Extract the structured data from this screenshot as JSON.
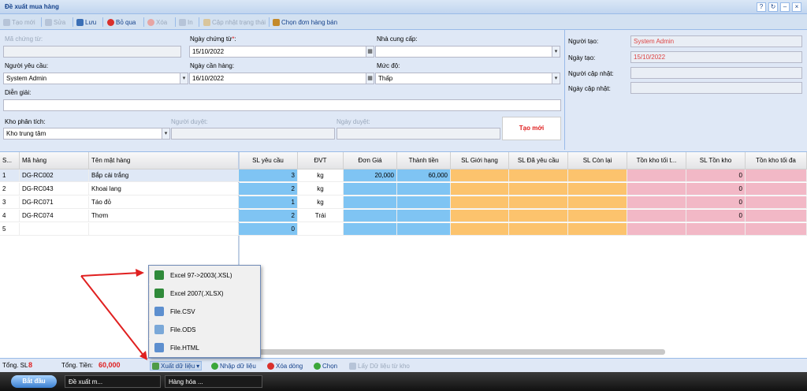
{
  "window": {
    "title": "Đề xuất mua hàng"
  },
  "toolbar": {
    "new": "Tạo mới",
    "edit": "Sửa",
    "save": "Lưu",
    "skip": "Bỏ qua",
    "delete": "Xóa",
    "print": "In",
    "update_status": "Cập nhật trạng thái",
    "choose_order": "Chọn đơn hàng bán"
  },
  "form": {
    "doc_code_label": "Mã chứng từ:",
    "doc_code_value": "",
    "doc_date_label": "Ngày chứng từ",
    "required_mark": "*",
    "doc_date_value": "15/10/2022",
    "supplier_label": "Nhà cung cấp:",
    "supplier_value": "",
    "requester_label": "Người yêu cầu:",
    "requester_value": "System Admin",
    "need_date_label": "Ngày cần hàng:",
    "need_date_value": "16/10/2022",
    "level_label": "Mức độ:",
    "level_value": "Thấp",
    "desc_label": "Diễn giải:",
    "desc_value": "",
    "warehouse_label": "Kho phân tích:",
    "warehouse_value": "Kho trung tâm",
    "approver_label": "Người duyệt:",
    "approver_value": "",
    "approve_date_label": "Ngày duyệt:",
    "approve_date_value": "",
    "status_badge": "Tạo mới"
  },
  "meta": {
    "creator_label": "Người tạo:",
    "creator_value": "System Admin",
    "created_label": "Ngày tạo:",
    "created_value": "15/10/2022",
    "updater_label": "Người cập nhật:",
    "updater_value": "",
    "updated_label": "Ngày cập nhật:",
    "updated_value": ""
  },
  "grid": {
    "headers": [
      "S...",
      "Mã hàng",
      "Tên mặt hàng",
      "SL yêu cầu",
      "ĐVT",
      "Đơn Giá",
      "Thành tiền",
      "SL Giới hạng",
      "SL Đã yêu cầu",
      "SL Còn lại",
      "Tồn kho tối t...",
      "SL Tồn kho",
      "Tồn kho tối đa"
    ],
    "rows": [
      {
        "stt": "1",
        "code": "DG-RC002",
        "name": "Bắp cải trắng",
        "qty": "3",
        "unit": "kg",
        "price": "20,000",
        "total": "60,000",
        "stock": "0"
      },
      {
        "stt": "2",
        "code": "DG-RC043",
        "name": "Khoai lang",
        "qty": "2",
        "unit": "kg",
        "price": "",
        "total": "",
        "stock": "0"
      },
      {
        "stt": "3",
        "code": "DG-RC071",
        "name": "Táo đỏ",
        "qty": "1",
        "unit": "kg",
        "price": "",
        "total": "",
        "stock": "0"
      },
      {
        "stt": "4",
        "code": "DG-RC074",
        "name": "Thơm",
        "qty": "2",
        "unit": "Trái",
        "price": "",
        "total": "",
        "stock": "0"
      },
      {
        "stt": "5",
        "code": "",
        "name": "",
        "qty": "0",
        "unit": "",
        "price": "",
        "total": "",
        "stock": ""
      }
    ]
  },
  "export_menu": {
    "items": [
      "Excel 97->2003(.XSL)",
      "Excel 2007(.XLSX)",
      "File.CSV",
      "File.ODS",
      "File.HTML"
    ]
  },
  "footer": {
    "total_qty_label": "Tổng. SL",
    "total_qty_value": "8",
    "total_amount_label": "Tổng. Tiền:",
    "total_amount_value": "60,000",
    "export": "Xuất dữ liệu",
    "import": "Nhập dữ liệu",
    "delete_row": "Xóa dòng",
    "choose": "Chọn",
    "fetch_stock": "Lấy Dữ liệu từ kho"
  },
  "taskbar": {
    "start": "Bắt đầu",
    "task1": "Đề xuất m...",
    "task2": "Hàng hóa ..."
  },
  "colors": {
    "qty_col": "#7fc4f3",
    "limit_col": "#fcc36d",
    "stock_col": "#f2b8c6",
    "badge": "#e02020"
  }
}
